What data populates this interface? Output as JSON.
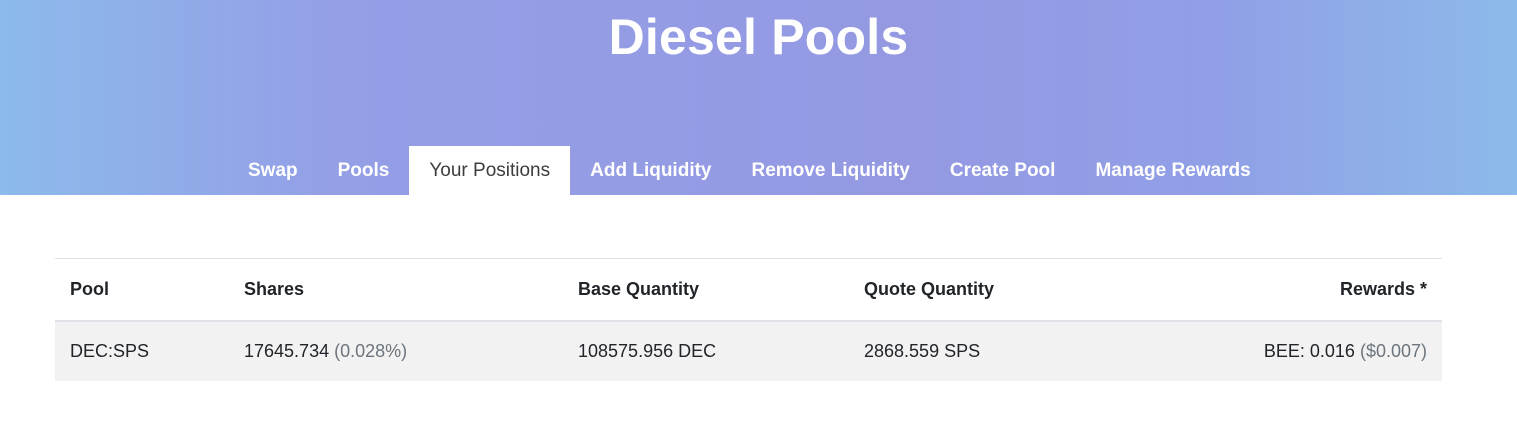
{
  "header": {
    "title": "Diesel Pools"
  },
  "tabs": [
    {
      "label": "Swap",
      "active": false
    },
    {
      "label": "Pools",
      "active": false
    },
    {
      "label": "Your Positions",
      "active": true
    },
    {
      "label": "Add Liquidity",
      "active": false
    },
    {
      "label": "Remove Liquidity",
      "active": false
    },
    {
      "label": "Create Pool",
      "active": false
    },
    {
      "label": "Manage Rewards",
      "active": false
    }
  ],
  "table": {
    "columns": [
      "Pool",
      "Shares",
      "Base Quantity",
      "Quote Quantity",
      "Rewards *"
    ],
    "rows": [
      {
        "pool": "DEC:SPS",
        "shares": "17645.734",
        "shares_pct": "(0.028%)",
        "base": "108575.956 DEC",
        "quote": "2868.559 SPS",
        "rewards": "BEE: 0.016",
        "rewards_usd": "($0.007)"
      }
    ]
  },
  "colors": {
    "gradient_edge": "#8cbaec",
    "gradient_center": "#9499e2",
    "muted_text": "#6c757d",
    "row_background": "#f2f2f2"
  }
}
